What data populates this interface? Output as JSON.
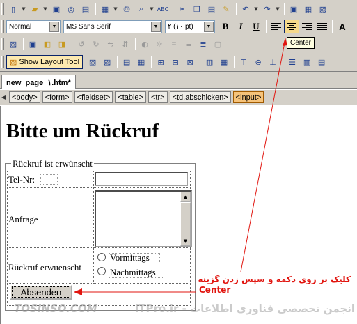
{
  "toolbar": {
    "row1_icons": [
      "new-icon",
      "open-icon",
      "save-icon",
      "find-icon",
      "preview-icon",
      "print-icon",
      "search-icon",
      "spellcheck-icon",
      "cut-icon",
      "copy-icon",
      "paste-icon",
      "format-painter-icon",
      "undo-icon",
      "redo-icon",
      "insert-table-icon",
      "grid-icon",
      "layout-icon"
    ],
    "style_value": "Normal",
    "font_value": "MS Sans Serif",
    "size_value": "۲ (۱۰ pt)",
    "bold": "B",
    "italic": "I",
    "underline": "U",
    "grow_font": "A",
    "layout_tool_label": "Show Layout Tool",
    "tooltip": "Center"
  },
  "document": {
    "tab_label": "new_page_۱.htm*"
  },
  "tags": [
    "<body>",
    "<form>",
    "<fieldset>",
    "<table>",
    "<tr>",
    "<td.abschicken>",
    "<input>"
  ],
  "page": {
    "title": "Bitte um Rückruf",
    "legend": "Rückruf ist erwünscht",
    "phone_label": "Tel-Nr:",
    "inquiry_label": "Anfrage",
    "callback_label": "Rückruf erwuenscht",
    "option_morning": "Vormittags",
    "option_afternoon": "Nachmittags",
    "submit_label": "Absenden"
  },
  "annotation": {
    "line1": "کلیک بر روی دکمه و سپس زدن گزینه",
    "line2": "Center"
  },
  "watermark": {
    "left": "TOSINSO.COM",
    "right": "ITPro.ir - انجمن تخصصی فناوری اطلاعات"
  },
  "colors": {
    "annotation": "#e1150f",
    "toolbar_bg": "#d4d0c8",
    "selected_tag": "#f6c37a",
    "active_button": "#f5d98b"
  }
}
